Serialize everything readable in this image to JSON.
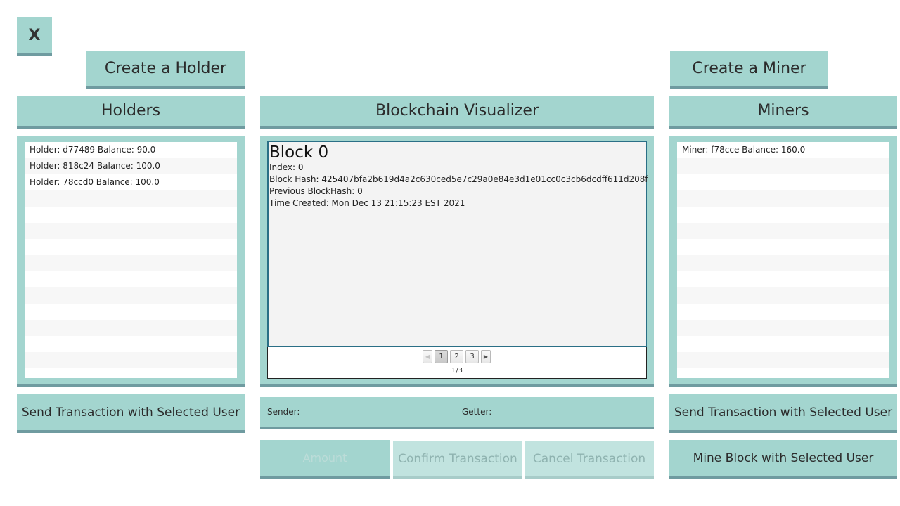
{
  "close_button": {
    "label": "X"
  },
  "holders": {
    "create_label": "Create a Holder",
    "header": "Holders",
    "items": [
      "Holder: d77489 Balance: 90.0",
      "Holder: 818c24 Balance: 100.0",
      "Holder: 78ccd0 Balance: 100.0"
    ],
    "send_label": "Send Transaction with Selected User"
  },
  "visualizer": {
    "header": "Blockchain Visualizer",
    "block": {
      "title": "Block 0",
      "index": "Index: 0",
      "hash": "Block Hash: 425407bfa2b619d4a2c630ced5e7c29a0e84e3d1e01cc0c3cb6dcdff611d208f",
      "prev_hash": "Previous BlockHash: 0",
      "time_created": "Time Created: Mon Dec 13 21:15:23 EST 2021"
    },
    "pagination": {
      "pages": [
        "1",
        "2",
        "3"
      ],
      "current_page": 1,
      "page_indicator": "1/3"
    }
  },
  "transaction": {
    "sender_label": "Sender:",
    "getter_label": "Getter:",
    "amount_placeholder": "Amount",
    "confirm_label": "Confirm Transaction",
    "cancel_label": "Cancel Transaction"
  },
  "miners": {
    "create_label": "Create a Miner",
    "header": "Miners",
    "items": [
      "Miner: f78cce Balance: 160.0"
    ],
    "send_label": "Send Transaction with Selected User",
    "mine_label": "Mine Block with Selected User"
  },
  "colors": {
    "accent": "#a3d5cf",
    "accent_shadow": "#6f9ba0",
    "disabled": "#c1e3df",
    "selection_border": "#2a6f86"
  }
}
